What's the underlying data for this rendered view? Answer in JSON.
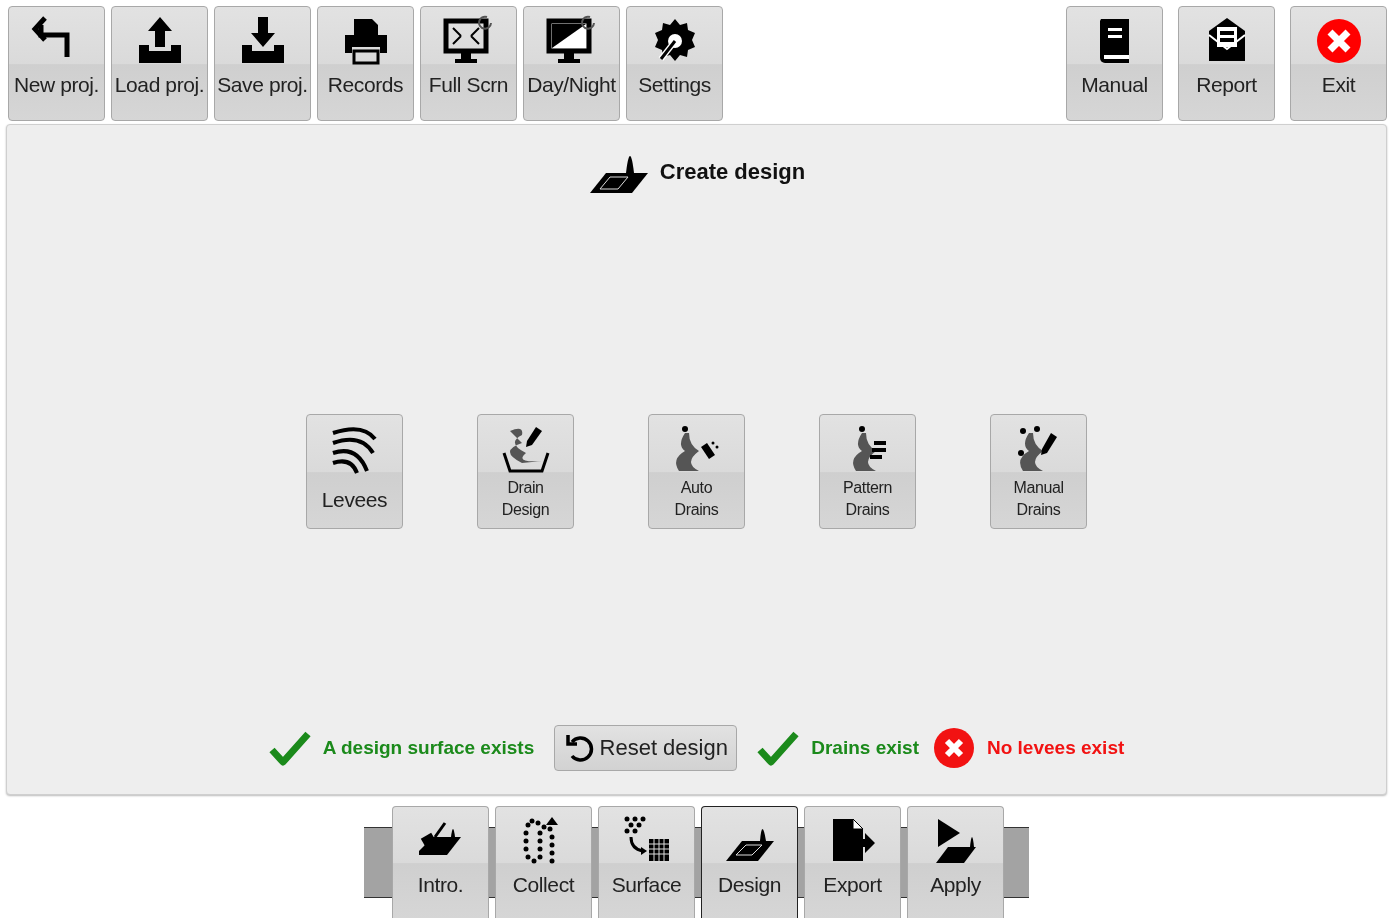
{
  "toolbar": {
    "left": [
      {
        "label": "New proj."
      },
      {
        "label": "Load proj."
      },
      {
        "label": "Save proj."
      },
      {
        "label": "Records"
      },
      {
        "label": "Full Scrn"
      },
      {
        "label": "Day/Night"
      },
      {
        "label": "Settings"
      }
    ],
    "right": [
      {
        "label": "Manual"
      },
      {
        "label": "Report"
      },
      {
        "label": "Exit"
      }
    ]
  },
  "panel": {
    "title": "Create design",
    "tools": [
      {
        "label": "Levees",
        "kind": "large"
      },
      {
        "label": "Drain Design",
        "kind": "small"
      },
      {
        "label": "Auto Drains",
        "kind": "small"
      },
      {
        "label": "Pattern Drains",
        "kind": "small"
      },
      {
        "label": "Manual Drains",
        "kind": "small"
      }
    ],
    "status": [
      {
        "kind": "indicator",
        "ok": true,
        "text": "A design surface exists"
      },
      {
        "kind": "button",
        "text": "Reset design"
      },
      {
        "kind": "indicator",
        "ok": true,
        "text": "Drains exist"
      },
      {
        "kind": "indicator",
        "ok": false,
        "text": "No levees exist"
      }
    ]
  },
  "tabs": [
    {
      "label": "Intro.",
      "selected": false
    },
    {
      "label": "Collect",
      "selected": false
    },
    {
      "label": "Surface",
      "selected": false
    },
    {
      "label": "Design",
      "selected": true
    },
    {
      "label": "Export",
      "selected": false
    },
    {
      "label": "Apply",
      "selected": false
    }
  ]
}
